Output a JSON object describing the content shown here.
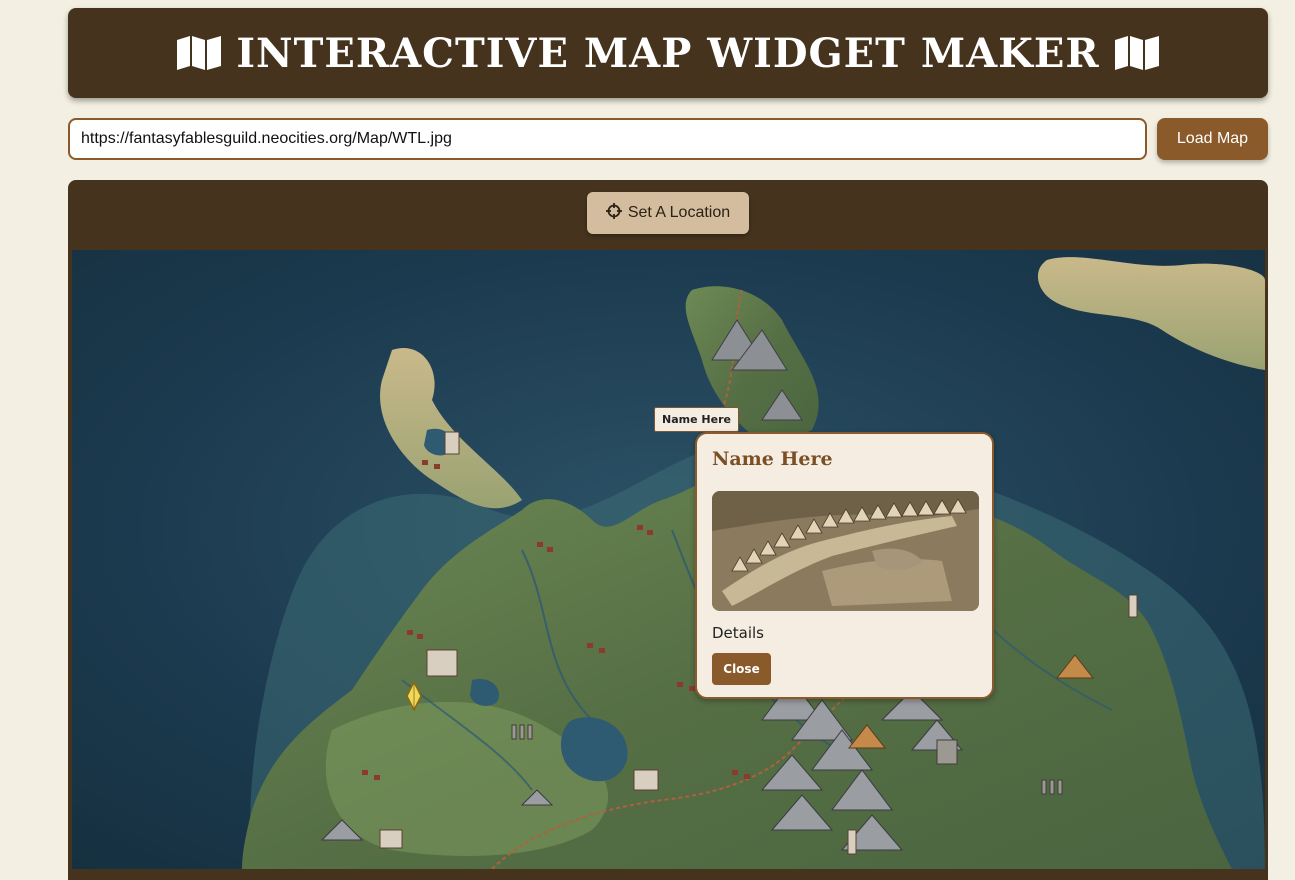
{
  "header": {
    "title": "INTERACTIVE MAP WIDGET MAKER",
    "icon_left": "map-icon",
    "icon_right": "map-icon"
  },
  "url_bar": {
    "value": "https://fantasyfablesguild.neocities.org/Map/WTL.jpg",
    "load_label": "Load Map"
  },
  "toolbar": {
    "set_location_label": "Set A Location",
    "set_location_icon": "crosshair-icon"
  },
  "map": {
    "marker_label": "Name Here",
    "marker_icon": "diamond-marker-icon",
    "popup": {
      "title": "Name Here",
      "details": "Details",
      "close_label": "Close"
    }
  },
  "colors": {
    "header_bg": "#45331d",
    "accent": "#8a5a2b",
    "page_bg": "#f3efe2",
    "set_button_bg": "#d3bd9e",
    "popup_bg": "#f6ede2"
  }
}
